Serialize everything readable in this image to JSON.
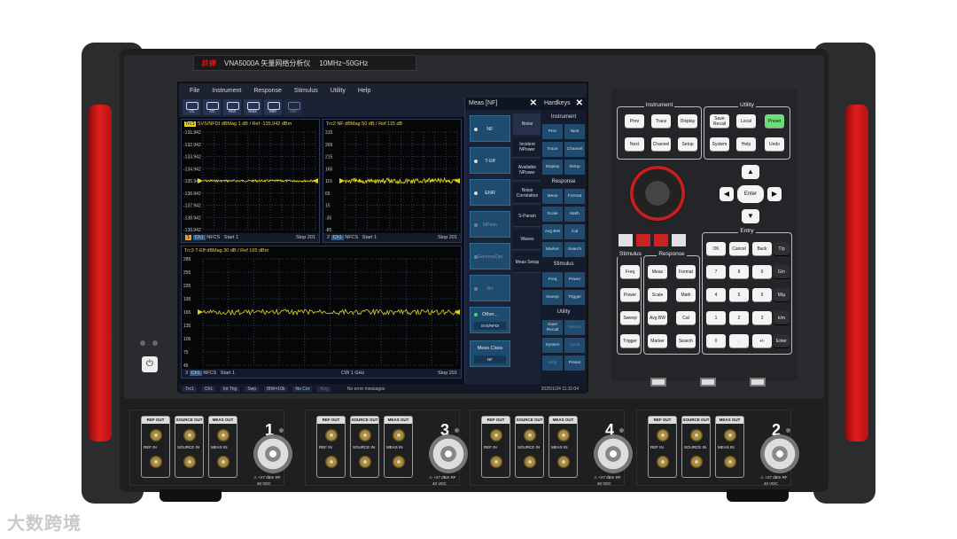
{
  "brand": {
    "logo": "玖锦",
    "model": "VNA5000A 矢量网络分析仪",
    "range": "10MHz~50GHz"
  },
  "menu": [
    "File",
    "Instrument",
    "Response",
    "Stimulus",
    "Utility",
    "Help"
  ],
  "toolbar": [
    "Trc",
    "Trc",
    "Win",
    "Max",
    "Mkr",
    "Mkr"
  ],
  "plots": [
    {
      "header": "SVS/NFDI dBMag 1 dB / Ref -135.942 dBm",
      "trace_tag": "Trc1",
      "channel": "1",
      "footer_ch": "Ch1",
      "footer_mode": "NFCS",
      "footer_start": "Start 1",
      "footer_stop": "Stop 201",
      "ticks": [
        "-131.942",
        "-132.942",
        "-133.942",
        "-134.942",
        "-135.942",
        "-136.942",
        "-137.942",
        "-138.942",
        "-139.942"
      ]
    },
    {
      "header": "Trc2 NF dBMag 50 dB / Ref 115 dB",
      "channel": "2",
      "footer_ch": "Ch1",
      "footer_mode": "NFCS",
      "footer_start": "Start 1",
      "footer_stop": "Stop 201",
      "ticks": [
        "315",
        "265",
        "215",
        "165",
        "115",
        "65",
        "15",
        "-35",
        "-85"
      ]
    },
    {
      "header": "Trc3 T-Eff dBMag 30 dB / Ref 165 dBm",
      "channel": "3",
      "footer_ch": "Ch1",
      "footer_mode": "NFCS",
      "footer_start": "Start 1",
      "footer_stop": "CW 1 GHz",
      "footer_end": "Stop 201",
      "ticks": [
        "285",
        "255",
        "225",
        "195",
        "165",
        "135",
        "105",
        "75",
        "45"
      ]
    }
  ],
  "meas_panel": {
    "title": "Meas [NF]",
    "buttons": [
      "NF",
      "T-Eff",
      "ENR",
      "NPwin",
      "GammaOpt",
      "Rn",
      "Other...",
      "Meas Class"
    ],
    "other_sub": "SVS/NFDI",
    "class_sub": "NF",
    "tabs": [
      "Noise",
      "Incident NPower",
      "Available NPower",
      "Noise Correlation",
      "S-Param",
      "Waves",
      "Meas Setup"
    ]
  },
  "hardkeys": {
    "title": "Hardkeys",
    "sections": [
      "Instrument",
      "Response",
      "Stimulus",
      "Utility"
    ],
    "instrument": [
      "Prev",
      "Next",
      "Trace",
      "Channel",
      "Display",
      "Setup"
    ],
    "response": [
      "Meas",
      "Format",
      "Scale",
      "Math",
      "Avg BW",
      "Cal",
      "Marker",
      "Search"
    ],
    "stimulus": [
      "Freq",
      "Power",
      "Sweep",
      "Trigger"
    ],
    "utility": [
      "Save Recall",
      "Macro",
      "System",
      "Local",
      "Help",
      "Preset"
    ]
  },
  "statusbar": {
    "items": [
      "Trc1",
      "Ch1",
      "Int Trig",
      "Swp",
      "IBW=10k",
      "No Cor",
      "Avg"
    ],
    "message": "No error messages",
    "time": "2025/1/24 11:11:04"
  },
  "keypad": {
    "instrument_label": "Instrument",
    "utility_label": "Utility",
    "instrument_keys": [
      "Prev",
      "Trace",
      "Display",
      "Next",
      "Channel",
      "Setup"
    ],
    "utility_keys": [
      "Save Recall",
      "Local",
      "Preset",
      "System",
      "Help",
      "Undo"
    ],
    "enter": "Enter",
    "stimulus_label": "Stimulus",
    "response_label": "Response",
    "entry_label": "Entry",
    "stimulus_keys": [
      "Freq",
      "Power",
      "Sweep",
      "Trigger"
    ],
    "response_keys": [
      "Meas",
      "Format",
      "Scale",
      "Math",
      "Avg BW",
      "Cal",
      "Marker",
      "Search"
    ],
    "entry_top": [
      "OK",
      "Cancel",
      "Back"
    ],
    "numbers": [
      "7",
      "8",
      "9",
      "4",
      "5",
      "6",
      "1",
      "2",
      "3",
      "0",
      ".",
      "+/-"
    ],
    "units": [
      "T/p",
      "G/n",
      "M/μ",
      "k/m",
      "Enter"
    ]
  },
  "ports": {
    "groups": [
      "REF OUT",
      "SOURCE OUT",
      "MEAS OUT"
    ],
    "ins": [
      "REF IN",
      "SOURCE IN",
      "MEAS IN"
    ],
    "numbers": [
      "1",
      "3",
      "4",
      "2"
    ],
    "rating1": "+27 dBm RF",
    "rating2": "40 VDC"
  },
  "watermark": "大数跨境",
  "colors": {
    "trace": "#e7d21a",
    "accent_red": "#e21d1d",
    "panel_blue": "#1f4b6e",
    "preset_green": "#6fdc7a"
  }
}
